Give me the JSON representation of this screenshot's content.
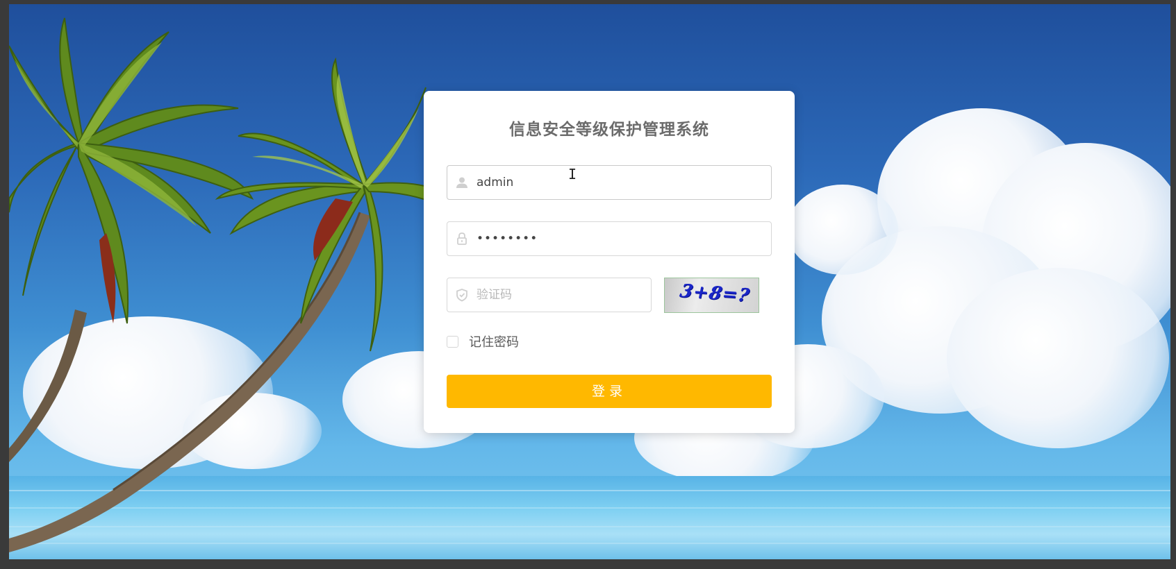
{
  "app": {
    "title": "信息安全等级保护管理系统"
  },
  "login_form": {
    "username": {
      "value": "admin",
      "icon": "user-icon"
    },
    "password": {
      "value": "••••••••",
      "icon": "lock-icon"
    },
    "captcha": {
      "value": "",
      "placeholder": "验证码",
      "icon": "shield-icon",
      "image_text": "3+8=?"
    },
    "remember": {
      "label": "记住密码",
      "checked": false
    },
    "submit_label": "登录"
  },
  "colors": {
    "primary_button": "#ffb800",
    "title_text": "#6b6b6b",
    "captcha_text": "#1a26c8"
  }
}
